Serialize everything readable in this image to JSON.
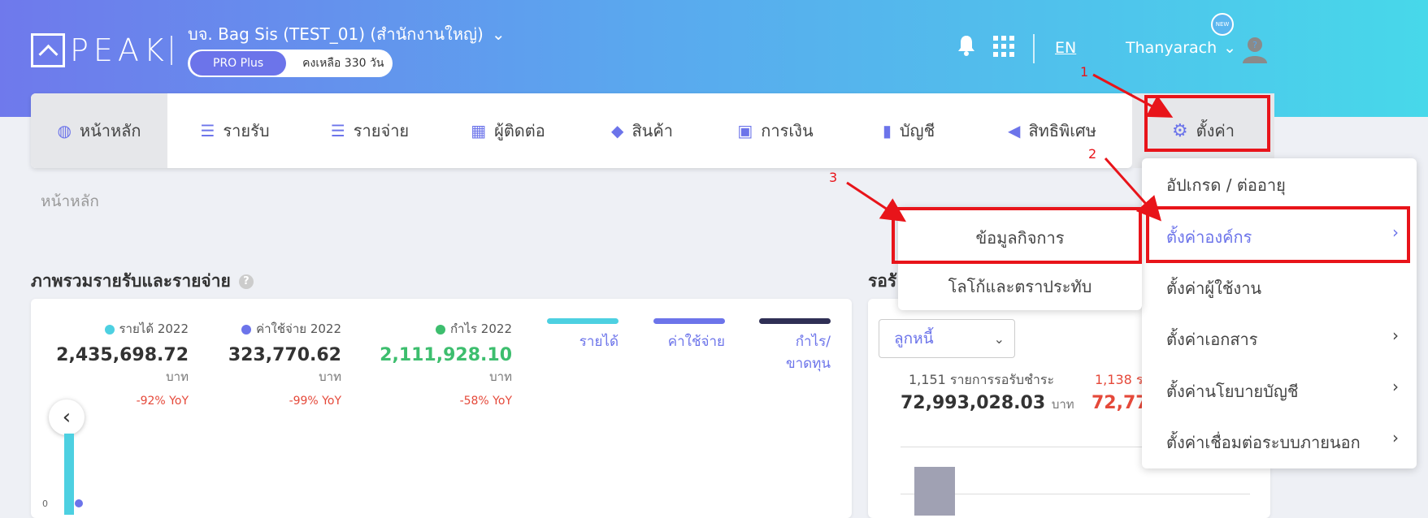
{
  "brand": {
    "logo_text": "PEAK"
  },
  "header": {
    "company": "บจ. Bag Sis (TEST_01) (สำนักงานใหญ่)",
    "plan": "PRO Plus",
    "remaining": "คงเหลือ 330 วัน",
    "language": "EN",
    "user": "Thanyarach",
    "new_badge": "NEW"
  },
  "nav": {
    "items": [
      {
        "label": "หน้าหลัก",
        "icon": "dashboard-icon"
      },
      {
        "label": "รายรับ",
        "icon": "income-icon"
      },
      {
        "label": "รายจ่าย",
        "icon": "expense-icon"
      },
      {
        "label": "ผู้ติดต่อ",
        "icon": "contacts-icon"
      },
      {
        "label": "สินค้า",
        "icon": "product-box-icon"
      },
      {
        "label": "การเงิน",
        "icon": "money-icon"
      },
      {
        "label": "บัญชี",
        "icon": "ledger-icon"
      },
      {
        "label": "สิทธิพิเศษ",
        "icon": "megaphone-icon"
      }
    ],
    "settings_label": "ตั้งค่า"
  },
  "breadcrumb": "หน้าหลัก",
  "overview": {
    "title": "ภาพรวมรายรับและรายจ่าย",
    "help": "?",
    "stats": [
      {
        "label": "รายได้ 2022",
        "value": "2,435,698.72",
        "unit": "บาท",
        "yoy": "-92% YoY",
        "color": "#4dd0e1"
      },
      {
        "label": "ค่าใช้จ่าย 2022",
        "value": "323,770.62",
        "unit": "บาท",
        "yoy": "-99% YoY",
        "color": "#6c74ea"
      },
      {
        "label": "กำไร 2022",
        "value": "2,111,928.10",
        "unit": "บาท",
        "yoy": "-58% YoY",
        "color": "#3dbe6e"
      }
    ],
    "legend": [
      {
        "label": "รายได้",
        "color": "#4dd0e1"
      },
      {
        "label": "ค่าใช้จ่าย",
        "color": "#6c74ea"
      },
      {
        "label": "กำไร/ขาดทุน",
        "color": "#2f2f55"
      }
    ],
    "axis_tick": "0"
  },
  "receivables": {
    "title": "รอรั",
    "select_value": "ลูกหนี้",
    "count_label": "1,151 รายการรอรับชำระ",
    "amount": "72,993,028.03",
    "unit": "บาท",
    "overdue_count": "1,138 ร",
    "overdue_amount": "72,773"
  },
  "settings_menu": {
    "items": [
      {
        "label": "อัปเกรด / ต่ออายุ",
        "chevron": ""
      },
      {
        "label": "ตั้งค่าองค์กร",
        "chevron": "›"
      },
      {
        "label": "ตั้งค่าผู้ใช้งาน",
        "chevron": ""
      },
      {
        "label": "ตั้งค่าเอกสาร",
        "chevron": "›"
      },
      {
        "label": "ตั้งค่านโยบายบัญชี",
        "chevron": "›"
      },
      {
        "label": "ตั้งค่าเชื่อมต่อระบบภายนอก",
        "chevron": "›"
      }
    ]
  },
  "org_submenu": {
    "items": [
      "ข้อมูลกิจการ",
      "โลโก้และตราประทับ"
    ]
  },
  "annotations": {
    "steps": [
      "1",
      "2",
      "3"
    ],
    "color": "#e8141a"
  }
}
